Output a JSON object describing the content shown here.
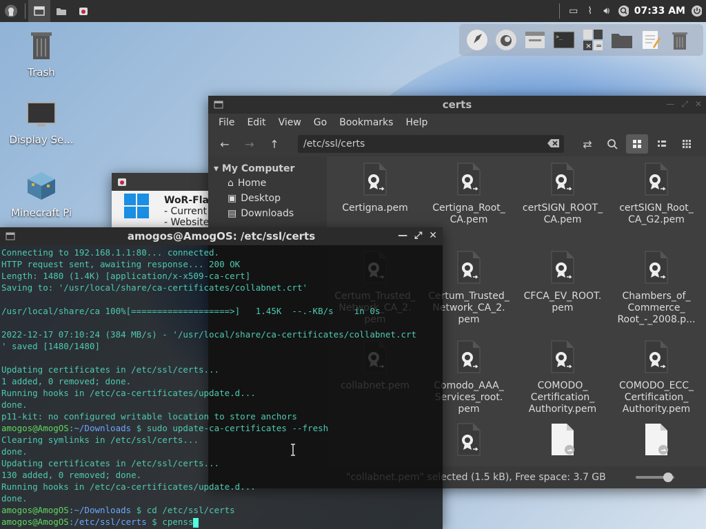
{
  "panel": {
    "clock": "07:33 AM"
  },
  "desktop": {
    "icons": [
      {
        "label": "Trash"
      },
      {
        "label": "Display Se..."
      },
      {
        "label": "Minecraft Pi"
      }
    ]
  },
  "pi_window": {
    "title": "WoR-Fla",
    "line1": "- Current",
    "line2": "- Website"
  },
  "file_manager": {
    "title": "certs",
    "menu": [
      "File",
      "Edit",
      "View",
      "Go",
      "Bookmarks",
      "Help"
    ],
    "location": "/etc/ssl/certs",
    "sidebar": {
      "header": "My Computer",
      "items": [
        "Home",
        "Desktop",
        "Downloads"
      ]
    },
    "files": [
      {
        "name": "Certigna.pem"
      },
      {
        "name": "Certigna_Root_ CA.pem"
      },
      {
        "name": "certSIGN_ROOT_ CA.pem"
      },
      {
        "name": "certSIGN_Root_ CA_G2.pem"
      },
      {
        "name": "Certum_Trusted_ Network_CA_2. pem"
      },
      {
        "name": "Certum_Trusted_ Network_CA_2. pem"
      },
      {
        "name": "CFCA_EV_ROOT. pem"
      },
      {
        "name": "Chambers_of_ Commerce_ Root_-_2008.p..."
      },
      {
        "name": "collabnet.pem"
      },
      {
        "name": "Comodo_AAA_ Services_root. pem"
      },
      {
        "name": "COMODO_ Certification_ Authority.pem"
      },
      {
        "name": "COMODO_ECC_ Certification_ Authority.pem"
      }
    ],
    "status": "\"collabnet.pem\" selected (1.5 kB), Free space: 3.7 GB"
  },
  "terminal": {
    "title": "amogos@AmogOS: /etc/ssl/certs",
    "lines": [
      "Connecting to 192.168.1.1:80... connected.",
      "HTTP request sent, awaiting response... 200 OK",
      "Length: 1480 (1.4K) [application/x-x509-ca-cert]",
      "Saving to: '/usr/local/share/ca-certificates/collabnet.crt'",
      "",
      "/usr/local/share/ca 100%[===================>]   1.45K  --.-KB/s    in 0s",
      "",
      "2022-12-17 07:10:24 (384 MB/s) - '/usr/local/share/ca-certificates/collabnet.crt",
      "' saved [1480/1480]",
      "",
      "Updating certificates in /etc/ssl/certs...",
      "1 added, 0 removed; done.",
      "Running hooks in /etc/ca-certificates/update.d...",
      "done.",
      "p11-kit: no configured writable location to store anchors"
    ],
    "prompt_user": "amogos@AmogOS",
    "prompt_dir1": "~/Downloads",
    "cmd1": "sudo update-ca-certificates --fresh",
    "lines2": [
      "Clearing symlinks in /etc/ssl/certs...",
      "done.",
      "Updating certificates in /etc/ssl/certs...",
      "130 added, 0 removed; done.",
      "Running hooks in /etc/ca-certificates/update.d...",
      "done."
    ],
    "cmd2": "cd /etc/ssl/certs",
    "prompt_dir2": "/etc/ssl/certs",
    "cmd3": "cpenss"
  }
}
